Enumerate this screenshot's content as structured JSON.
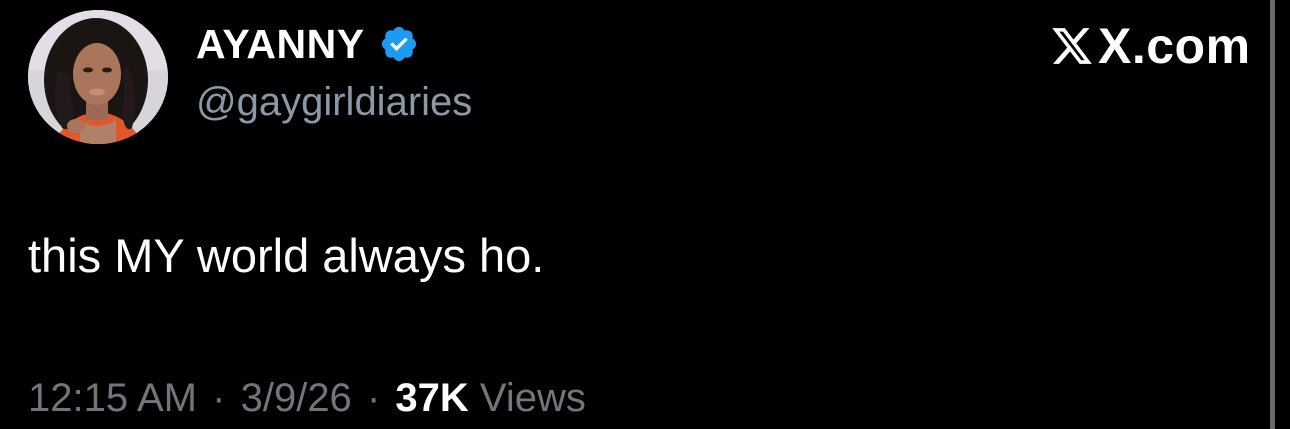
{
  "author": {
    "display_name": "AYANNY",
    "handle": "@gaygirldiaries",
    "verified_icon": "verified-badge-icon",
    "badge_color": "#1d9bf0"
  },
  "brand": {
    "text": "X.com"
  },
  "tweet": {
    "text": "this MY world always ho."
  },
  "meta": {
    "time": "12:15 AM",
    "separator": "·",
    "date": "3/9/26",
    "views_count": "37K",
    "views_label": "Views"
  },
  "colors": {
    "background": "#000000",
    "primary_text": "#ffffff",
    "secondary_text": "#71767b",
    "accent": "#1d9bf0"
  }
}
